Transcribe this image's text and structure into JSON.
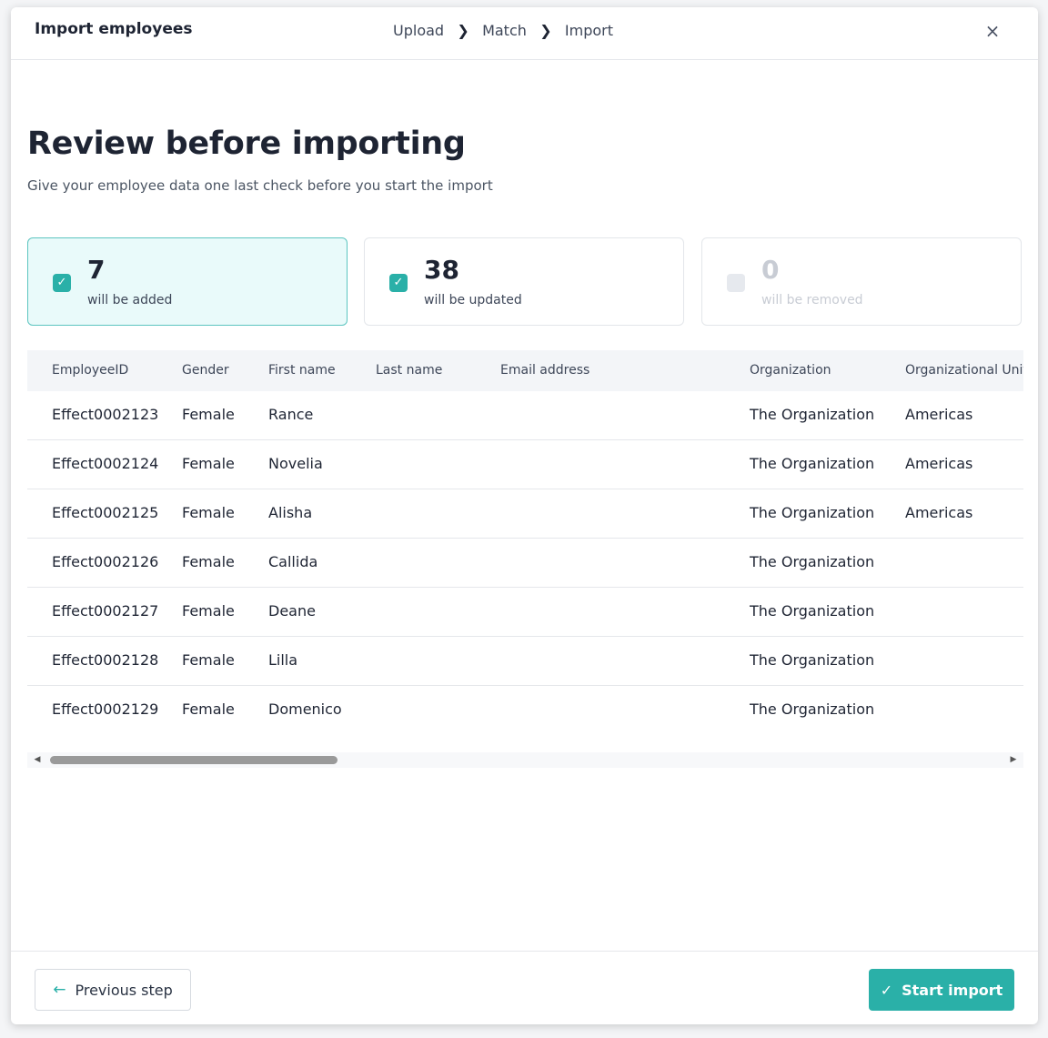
{
  "header": {
    "title": "Import employees",
    "steps": [
      "Upload",
      "Match",
      "Import"
    ],
    "close_icon": "×"
  },
  "main": {
    "title": "Review before importing",
    "subtitle": "Give your employee data one last check before you start the import"
  },
  "summary_cards": [
    {
      "count": "7",
      "label": "will be added",
      "checked": true,
      "state": "active"
    },
    {
      "count": "38",
      "label": "will be updated",
      "checked": true,
      "state": "normal"
    },
    {
      "count": "0",
      "label": "will be removed",
      "checked": false,
      "state": "disabled"
    }
  ],
  "table": {
    "columns": [
      "EmployeeID",
      "Gender",
      "First name",
      "Last name",
      "Email address",
      "Organization",
      "Organizational Unit"
    ],
    "rows": [
      [
        "Effect0002123",
        "Female",
        "Rance",
        "",
        "",
        "The Organization",
        "Americas"
      ],
      [
        "Effect0002124",
        "Female",
        "Novelia",
        "",
        "",
        "The Organization",
        "Americas"
      ],
      [
        "Effect0002125",
        "Female",
        "Alisha",
        "",
        "",
        "The Organization",
        "Americas"
      ],
      [
        "Effect0002126",
        "Female",
        "Callida",
        "",
        "",
        "The Organization",
        ""
      ],
      [
        "Effect0002127",
        "Female",
        "Deane",
        "",
        "",
        "The Organization",
        ""
      ],
      [
        "Effect0002128",
        "Female",
        "Lilla",
        "",
        "",
        "The Organization",
        ""
      ],
      [
        "Effect0002129",
        "Female",
        "Domenico",
        "",
        "",
        "The Organization",
        ""
      ]
    ]
  },
  "footer": {
    "previous_label": "Previous step",
    "start_label": "Start import"
  },
  "colors": {
    "accent": "#2ab0a8",
    "active_card_bg": "#e9fafa",
    "text_dark": "#1e2433"
  }
}
